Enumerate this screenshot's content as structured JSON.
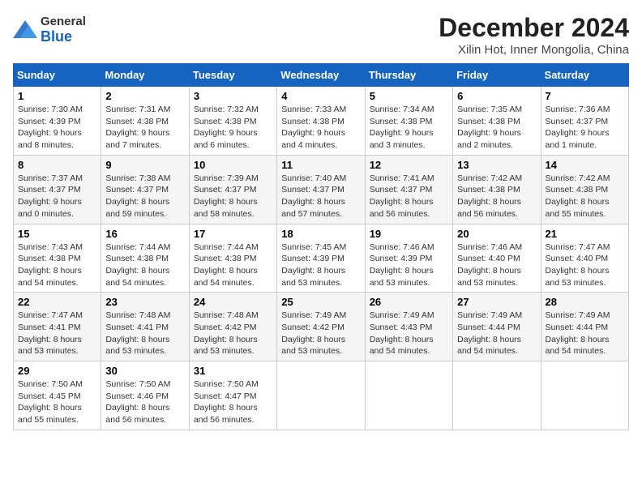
{
  "logo": {
    "general": "General",
    "blue": "Blue"
  },
  "title": "December 2024",
  "location": "Xilin Hot, Inner Mongolia, China",
  "weekdays": [
    "Sunday",
    "Monday",
    "Tuesday",
    "Wednesday",
    "Thursday",
    "Friday",
    "Saturday"
  ],
  "weeks": [
    [
      {
        "day": "1",
        "sunrise": "Sunrise: 7:30 AM",
        "sunset": "Sunset: 4:39 PM",
        "daylight": "Daylight: 9 hours and 8 minutes."
      },
      {
        "day": "2",
        "sunrise": "Sunrise: 7:31 AM",
        "sunset": "Sunset: 4:38 PM",
        "daylight": "Daylight: 9 hours and 7 minutes."
      },
      {
        "day": "3",
        "sunrise": "Sunrise: 7:32 AM",
        "sunset": "Sunset: 4:38 PM",
        "daylight": "Daylight: 9 hours and 6 minutes."
      },
      {
        "day": "4",
        "sunrise": "Sunrise: 7:33 AM",
        "sunset": "Sunset: 4:38 PM",
        "daylight": "Daylight: 9 hours and 4 minutes."
      },
      {
        "day": "5",
        "sunrise": "Sunrise: 7:34 AM",
        "sunset": "Sunset: 4:38 PM",
        "daylight": "Daylight: 9 hours and 3 minutes."
      },
      {
        "day": "6",
        "sunrise": "Sunrise: 7:35 AM",
        "sunset": "Sunset: 4:38 PM",
        "daylight": "Daylight: 9 hours and 2 minutes."
      },
      {
        "day": "7",
        "sunrise": "Sunrise: 7:36 AM",
        "sunset": "Sunset: 4:37 PM",
        "daylight": "Daylight: 9 hours and 1 minute."
      }
    ],
    [
      {
        "day": "8",
        "sunrise": "Sunrise: 7:37 AM",
        "sunset": "Sunset: 4:37 PM",
        "daylight": "Daylight: 9 hours and 0 minutes."
      },
      {
        "day": "9",
        "sunrise": "Sunrise: 7:38 AM",
        "sunset": "Sunset: 4:37 PM",
        "daylight": "Daylight: 8 hours and 59 minutes."
      },
      {
        "day": "10",
        "sunrise": "Sunrise: 7:39 AM",
        "sunset": "Sunset: 4:37 PM",
        "daylight": "Daylight: 8 hours and 58 minutes."
      },
      {
        "day": "11",
        "sunrise": "Sunrise: 7:40 AM",
        "sunset": "Sunset: 4:37 PM",
        "daylight": "Daylight: 8 hours and 57 minutes."
      },
      {
        "day": "12",
        "sunrise": "Sunrise: 7:41 AM",
        "sunset": "Sunset: 4:37 PM",
        "daylight": "Daylight: 8 hours and 56 minutes."
      },
      {
        "day": "13",
        "sunrise": "Sunrise: 7:42 AM",
        "sunset": "Sunset: 4:38 PM",
        "daylight": "Daylight: 8 hours and 56 minutes."
      },
      {
        "day": "14",
        "sunrise": "Sunrise: 7:42 AM",
        "sunset": "Sunset: 4:38 PM",
        "daylight": "Daylight: 8 hours and 55 minutes."
      }
    ],
    [
      {
        "day": "15",
        "sunrise": "Sunrise: 7:43 AM",
        "sunset": "Sunset: 4:38 PM",
        "daylight": "Daylight: 8 hours and 54 minutes."
      },
      {
        "day": "16",
        "sunrise": "Sunrise: 7:44 AM",
        "sunset": "Sunset: 4:38 PM",
        "daylight": "Daylight: 8 hours and 54 minutes."
      },
      {
        "day": "17",
        "sunrise": "Sunrise: 7:44 AM",
        "sunset": "Sunset: 4:38 PM",
        "daylight": "Daylight: 8 hours and 54 minutes."
      },
      {
        "day": "18",
        "sunrise": "Sunrise: 7:45 AM",
        "sunset": "Sunset: 4:39 PM",
        "daylight": "Daylight: 8 hours and 53 minutes."
      },
      {
        "day": "19",
        "sunrise": "Sunrise: 7:46 AM",
        "sunset": "Sunset: 4:39 PM",
        "daylight": "Daylight: 8 hours and 53 minutes."
      },
      {
        "day": "20",
        "sunrise": "Sunrise: 7:46 AM",
        "sunset": "Sunset: 4:40 PM",
        "daylight": "Daylight: 8 hours and 53 minutes."
      },
      {
        "day": "21",
        "sunrise": "Sunrise: 7:47 AM",
        "sunset": "Sunset: 4:40 PM",
        "daylight": "Daylight: 8 hours and 53 minutes."
      }
    ],
    [
      {
        "day": "22",
        "sunrise": "Sunrise: 7:47 AM",
        "sunset": "Sunset: 4:41 PM",
        "daylight": "Daylight: 8 hours and 53 minutes."
      },
      {
        "day": "23",
        "sunrise": "Sunrise: 7:48 AM",
        "sunset": "Sunset: 4:41 PM",
        "daylight": "Daylight: 8 hours and 53 minutes."
      },
      {
        "day": "24",
        "sunrise": "Sunrise: 7:48 AM",
        "sunset": "Sunset: 4:42 PM",
        "daylight": "Daylight: 8 hours and 53 minutes."
      },
      {
        "day": "25",
        "sunrise": "Sunrise: 7:49 AM",
        "sunset": "Sunset: 4:42 PM",
        "daylight": "Daylight: 8 hours and 53 minutes."
      },
      {
        "day": "26",
        "sunrise": "Sunrise: 7:49 AM",
        "sunset": "Sunset: 4:43 PM",
        "daylight": "Daylight: 8 hours and 54 minutes."
      },
      {
        "day": "27",
        "sunrise": "Sunrise: 7:49 AM",
        "sunset": "Sunset: 4:44 PM",
        "daylight": "Daylight: 8 hours and 54 minutes."
      },
      {
        "day": "28",
        "sunrise": "Sunrise: 7:49 AM",
        "sunset": "Sunset: 4:44 PM",
        "daylight": "Daylight: 8 hours and 54 minutes."
      }
    ],
    [
      {
        "day": "29",
        "sunrise": "Sunrise: 7:50 AM",
        "sunset": "Sunset: 4:45 PM",
        "daylight": "Daylight: 8 hours and 55 minutes."
      },
      {
        "day": "30",
        "sunrise": "Sunrise: 7:50 AM",
        "sunset": "Sunset: 4:46 PM",
        "daylight": "Daylight: 8 hours and 56 minutes."
      },
      {
        "day": "31",
        "sunrise": "Sunrise: 7:50 AM",
        "sunset": "Sunset: 4:47 PM",
        "daylight": "Daylight: 8 hours and 56 minutes."
      },
      null,
      null,
      null,
      null
    ]
  ]
}
